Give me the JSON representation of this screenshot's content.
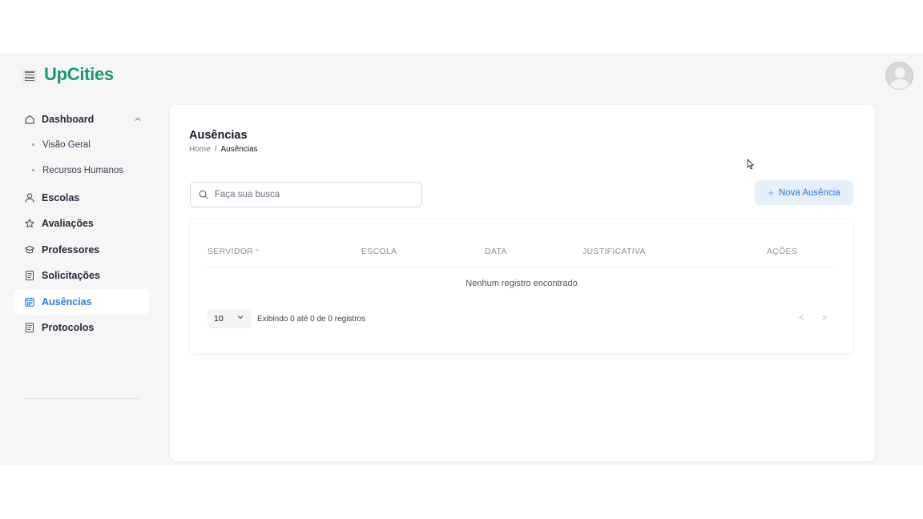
{
  "header": {
    "logo": "UpCities"
  },
  "sidebar": {
    "items": [
      {
        "label": "Dashboard",
        "icon": "home-icon",
        "expanded": true,
        "children": [
          {
            "label": "Visão Geral"
          },
          {
            "label": "Recursos Humanos"
          }
        ]
      },
      {
        "label": "Escolas",
        "icon": "user-icon"
      },
      {
        "label": "Avaliações",
        "icon": "star-icon"
      },
      {
        "label": "Professores",
        "icon": "graduation-cap-icon"
      },
      {
        "label": "Solicitações",
        "icon": "document-icon"
      },
      {
        "label": "Ausências",
        "icon": "calendar-icon",
        "active": true
      },
      {
        "label": "Protocolos",
        "icon": "document-icon"
      }
    ]
  },
  "page": {
    "title": "Ausências",
    "breadcrumb": {
      "home": "Home",
      "separator": "/",
      "current": "Ausências"
    }
  },
  "search": {
    "placeholder": "Faça sua busca"
  },
  "actions": {
    "new_label": "Nova Ausência"
  },
  "table": {
    "columns": [
      "SERVIDOR",
      "ESCOLA",
      "DATA",
      "JUSTIFICATIVA",
      "AÇÕES"
    ],
    "sorted_column": "SERVIDOR",
    "empty_message": "Nenhum registro encontrado",
    "page_size": "10",
    "showing_text": "Exibindo 0 até 0 de 0 registros",
    "prev": "<",
    "next": ">"
  },
  "colors": {
    "brand": "#1a9a6c",
    "accent": "#2b7ddb",
    "accent_soft": "#e6f0fb"
  }
}
